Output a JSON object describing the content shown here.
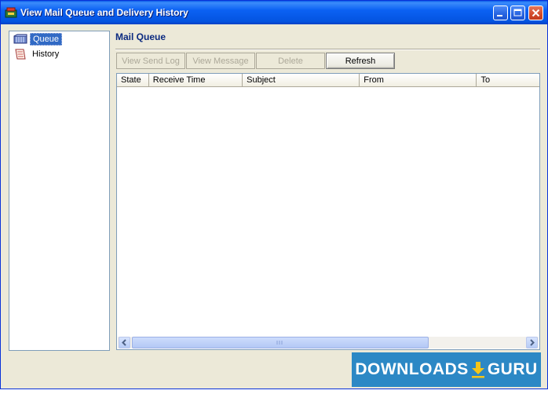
{
  "window": {
    "title": "View Mail Queue and Delivery History"
  },
  "tree": {
    "items": [
      {
        "label": "Queue",
        "icon": "queue-icon",
        "selected": true
      },
      {
        "label": "History",
        "icon": "history-icon",
        "selected": false
      }
    ]
  },
  "panel": {
    "title": "Mail Queue"
  },
  "toolbar": {
    "view_send_log": "View Send Log",
    "view_message": "View Message",
    "delete": "Delete",
    "refresh": "Refresh"
  },
  "table": {
    "columns": [
      "State",
      "Receive Time",
      "Subject",
      "From",
      "To"
    ],
    "rows": []
  },
  "watermark": {
    "left": "DOWNLOADS",
    "right": "GURU"
  },
  "colors": {
    "title_bar": "#0454e0",
    "selection": "#316ac5",
    "section_title": "#0b2a80",
    "watermark_bg": "#2c88c5",
    "watermark_arrow": "#f5c518"
  }
}
